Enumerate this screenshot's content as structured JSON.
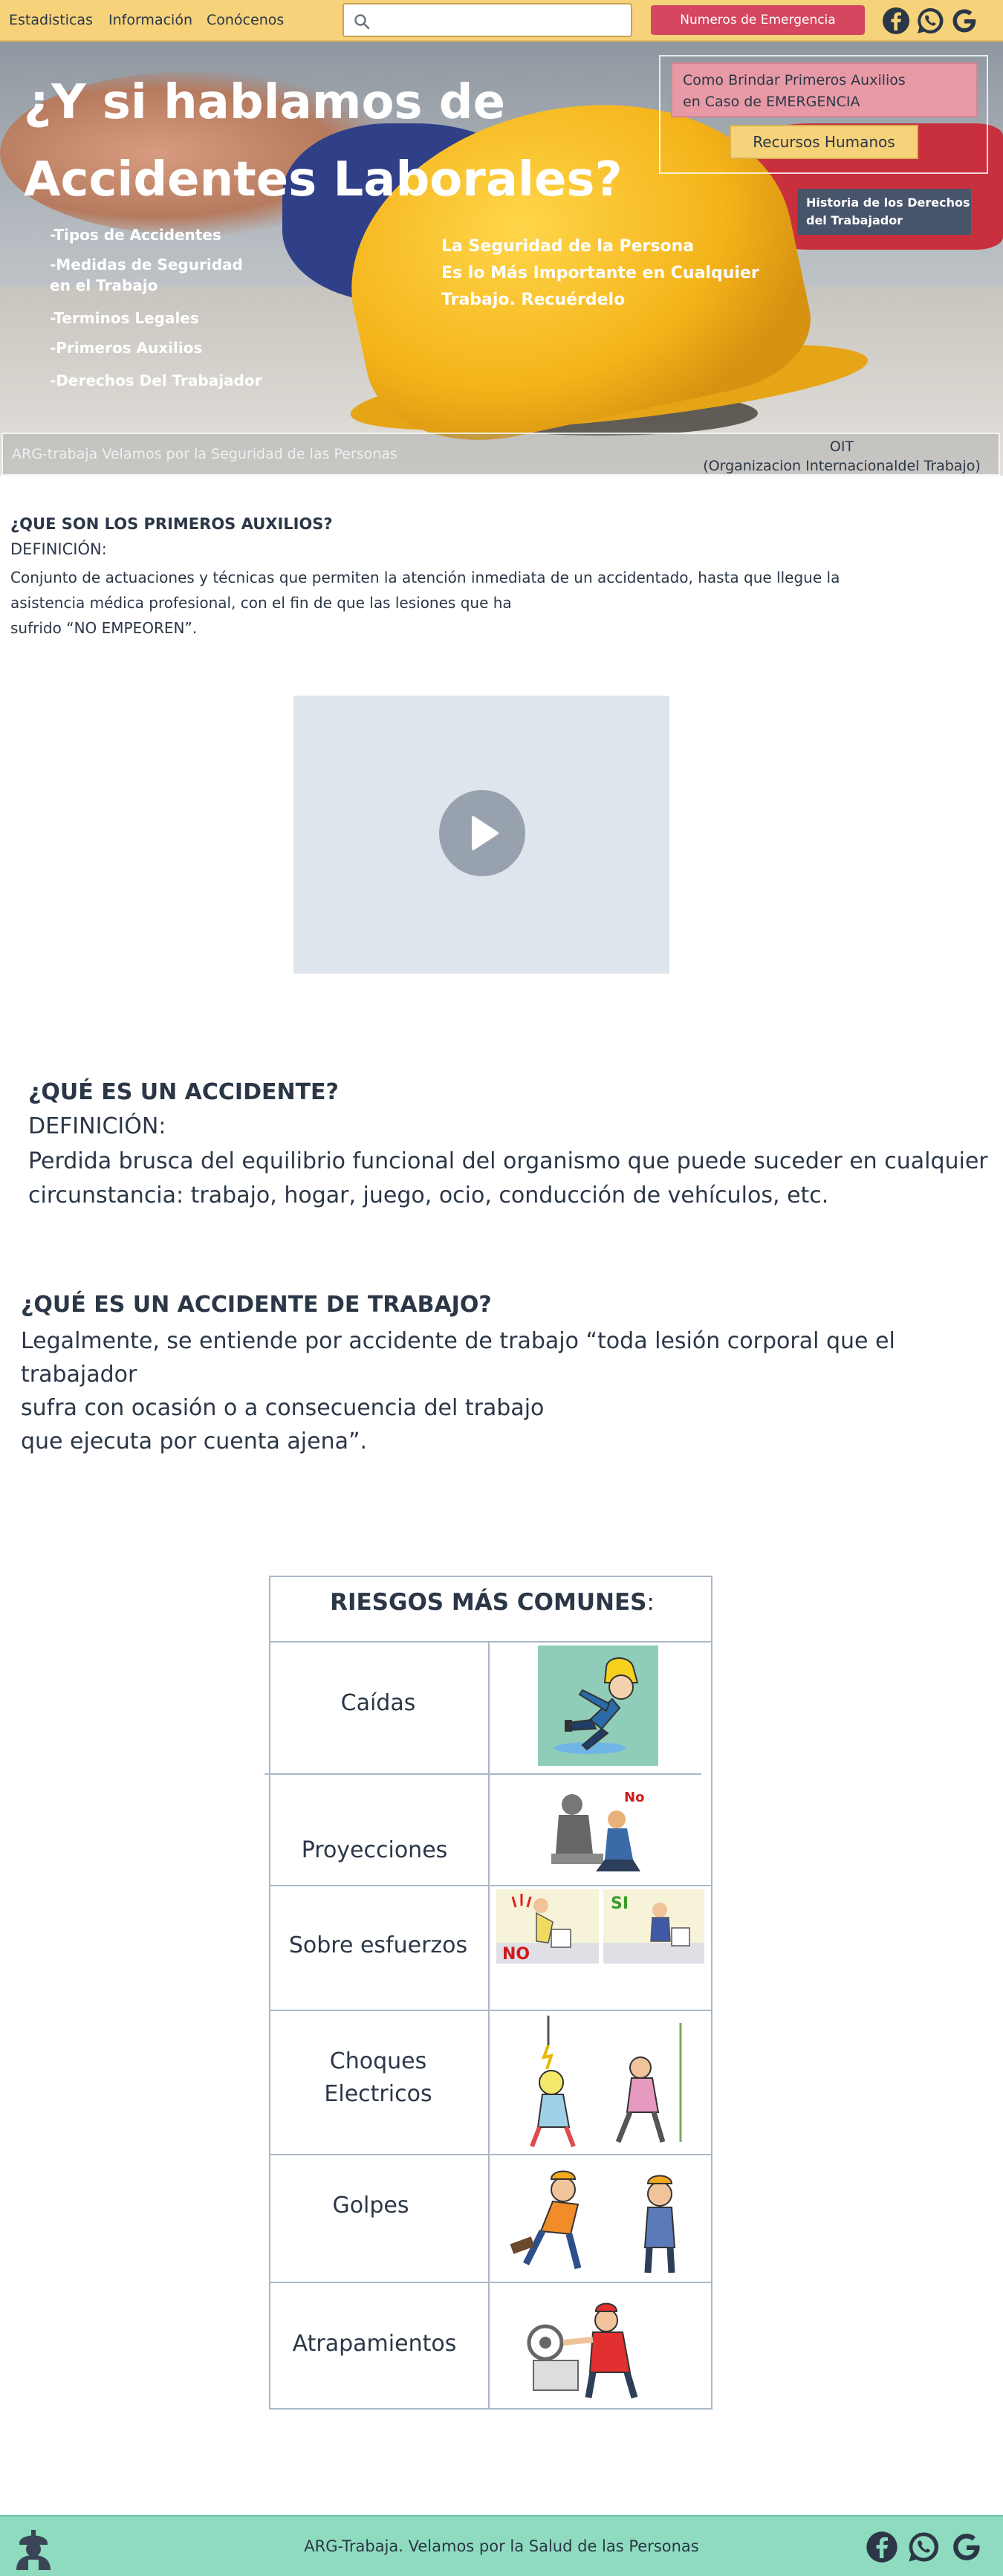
{
  "nav": {
    "links": [
      "Estadisticas",
      "Información",
      "Conócenos"
    ],
    "search_placeholder": "",
    "emergency_button": "Numeros de Emergencia",
    "social_icons": [
      "facebook-icon",
      "whatsapp-icon",
      "google-icon"
    ]
  },
  "hero": {
    "title_line1": "¿Y si hablamos de",
    "title_line2": "Accidentes Laborales?",
    "menu": [
      "-Tipos de Accidentes",
      "-Medidas de Seguridad",
      "en el Trabajo",
      "-Terminos Legales",
      "-Primeros Auxilios",
      "-Derechos Del Trabajador"
    ],
    "tagline_line1": "La Seguridad de la Persona",
    "tagline_line2": "Es lo Más Importante en Cualquier",
    "tagline_line3": "Trabajo. Recuérdelo",
    "first_aid_line1": "Como Brindar Primeros Auxilios",
    "first_aid_line2": "en Caso de EMERGENCIA",
    "hr_button": "Recursos Humanos",
    "history_line1": "Historia de los Derechos",
    "history_line2": "del Trabajador",
    "footer_text": "ARG-trabaja Velamos por la Seguridad de las Personas",
    "oit_line1": "OIT",
    "oit_line2": "(Organizacion Internacionaldel Trabajo)"
  },
  "first_aid": {
    "heading": "¿QUE SON LOS PRIMEROS AUXILIOS?",
    "definition_label": "DEFINICIÓN:",
    "line1": "Conjunto de actuaciones y técnicas que permiten la atención inmediata de un accidentado, hasta que llegue la",
    "line2": "asistencia médica profesional, con el fin de que las lesiones que ha",
    "line3": "sufrido “NO EMPEOREN”."
  },
  "accident": {
    "heading": "¿QUÉ ES UN ACCIDENTE?",
    "definition_label": "DEFINICIÓN:",
    "line1": "Perdida brusca del equilibrio funcional del organismo que puede suceder en cualquier",
    "line2": "circunstancia: trabajo, hogar, juego, ocio, conducción de vehículos, etc."
  },
  "work_accident": {
    "heading": "¿QUÉ ES UN ACCIDENTE DE TRABAJO?",
    "line1": "Legalmente, se entiende por accidente de trabajo “toda lesión corporal que el trabajador",
    "line2": "sufra con ocasión o a consecuencia del trabajo",
    "line3": "que ejecuta por cuenta ajena”."
  },
  "risks": {
    "title_bold": "RIESGOS MÁS COMUNES",
    "title_colon": ":",
    "items": [
      {
        "name_line1": "Caídas",
        "name_line2": ""
      },
      {
        "name_line1": "Proyecciones",
        "name_line2": ""
      },
      {
        "name_line1": "Sobre esfuerzos",
        "name_line2": ""
      },
      {
        "name_line1": "Choques",
        "name_line2": "Electricos"
      },
      {
        "name_line1": "Golpes",
        "name_line2": ""
      },
      {
        "name_line1": "Atrapamientos",
        "name_line2": ""
      }
    ],
    "img_labels": {
      "no": "No",
      "no_caps": "NO",
      "si": "SI"
    }
  },
  "footer": {
    "text": "ARG-Trabaja. Velamos por la Salud de las Personas",
    "social_icons": [
      "facebook-icon",
      "whatsapp-icon",
      "google-icon"
    ]
  },
  "colors": {
    "nav_bg": "#f6d27a",
    "emergency": "#d5465f",
    "footer_bg": "#8edbbf",
    "text": "#2b3747"
  }
}
